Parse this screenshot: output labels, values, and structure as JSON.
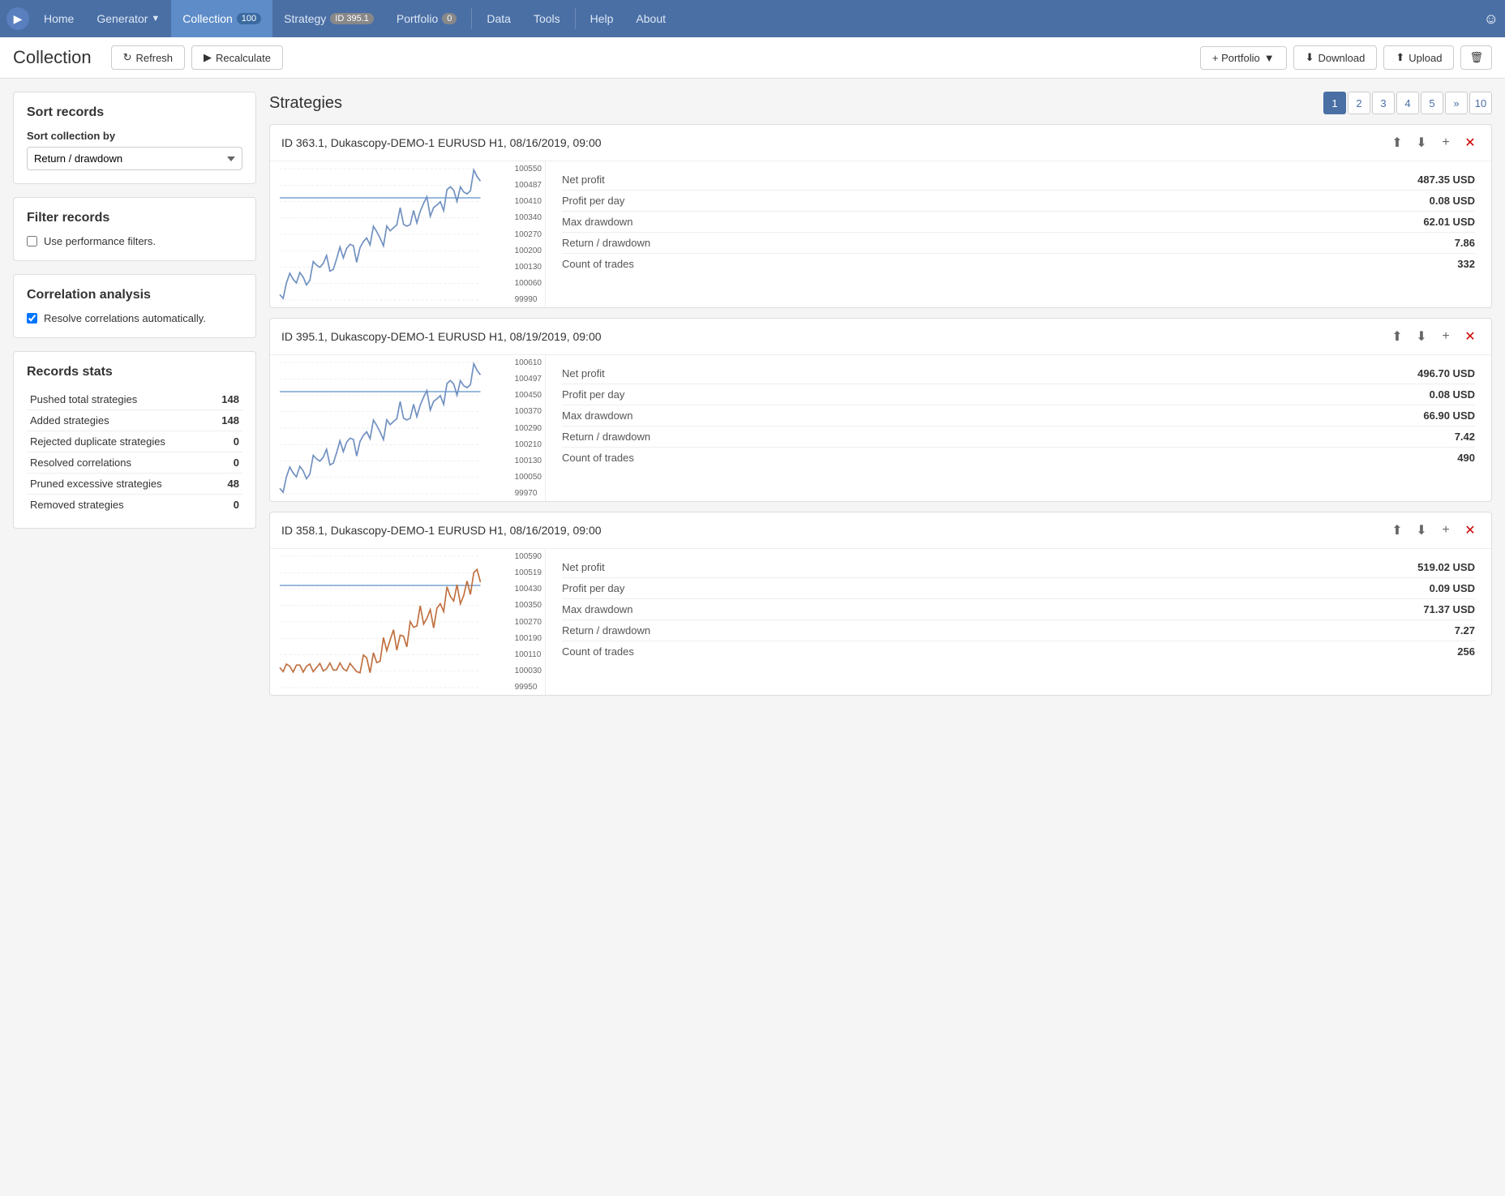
{
  "nav": {
    "home_label": "Home",
    "generator_label": "Generator",
    "collection_label": "Collection",
    "collection_badge": "100",
    "strategy_label": "Strategy",
    "strategy_id": "ID 395.1",
    "portfolio_label": "Portfolio",
    "portfolio_badge": "0",
    "data_label": "Data",
    "tools_label": "Tools",
    "help_label": "Help",
    "about_label": "About"
  },
  "toolbar": {
    "title": "Collection",
    "refresh_label": "Refresh",
    "recalculate_label": "Recalculate",
    "portfolio_label": "+ Portfolio",
    "download_label": "Download",
    "upload_label": "Upload"
  },
  "sidebar": {
    "sort_title": "Sort records",
    "sort_label": "Sort collection by",
    "sort_option": "Return / drawdown",
    "filter_title": "Filter records",
    "filter_checkbox_label": "Use performance filters.",
    "filter_checked": false,
    "correlation_title": "Correlation analysis",
    "correlation_checkbox_label": "Resolve correlations automatically.",
    "correlation_checked": true,
    "stats_title": "Records stats",
    "stats": [
      {
        "label": "Pushed total strategies",
        "value": "148"
      },
      {
        "label": "Added strategies",
        "value": "148"
      },
      {
        "label": "Rejected duplicate strategies",
        "value": "0"
      },
      {
        "label": "Resolved correlations",
        "value": "0"
      },
      {
        "label": "Pruned excessive strategies",
        "value": "48"
      },
      {
        "label": "Removed strategies",
        "value": "0"
      }
    ]
  },
  "content": {
    "title": "Strategies",
    "pagination": {
      "pages": [
        "1",
        "2",
        "3",
        "4",
        "5",
        "»",
        "10"
      ],
      "active": "1"
    },
    "strategies": [
      {
        "id": "ID 363.1",
        "info": "Dukascopy-DEMO-1 EURUSD H1, 08/16/2019, 09:00",
        "chart_labels": [
          "100550",
          "100487",
          "100410",
          "100340",
          "100270",
          "100200",
          "100130",
          "100060",
          "99990"
        ],
        "stats": [
          {
            "label": "Net profit",
            "value": "487.35 USD"
          },
          {
            "label": "Profit per day",
            "value": "0.08 USD"
          },
          {
            "label": "Max drawdown",
            "value": "62.01 USD"
          },
          {
            "label": "Return / drawdown",
            "value": "7.86"
          },
          {
            "label": "Count of trades",
            "value": "332"
          }
        ],
        "chart_color": "#7090c0",
        "trend": "up"
      },
      {
        "id": "ID 395.1",
        "info": "Dukascopy-DEMO-1 EURUSD H1, 08/19/2019, 09:00",
        "chart_labels": [
          "100610",
          "100497",
          "100450",
          "100370",
          "100290",
          "100210",
          "100130",
          "100050",
          "99970"
        ],
        "stats": [
          {
            "label": "Net profit",
            "value": "496.70 USD"
          },
          {
            "label": "Profit per day",
            "value": "0.08 USD"
          },
          {
            "label": "Max drawdown",
            "value": "66.90 USD"
          },
          {
            "label": "Return / drawdown",
            "value": "7.42"
          },
          {
            "label": "Count of trades",
            "value": "490"
          }
        ],
        "chart_color": "#7090c0",
        "trend": "up"
      },
      {
        "id": "ID 358.1",
        "info": "Dukascopy-DEMO-1 EURUSD H1, 08/16/2019, 09:00",
        "chart_labels": [
          "100590",
          "100519",
          "100430",
          "100350",
          "100270",
          "100190",
          "100110",
          "100030",
          "99950"
        ],
        "stats": [
          {
            "label": "Net profit",
            "value": "519.02 USD"
          },
          {
            "label": "Profit per day",
            "value": "0.09 USD"
          },
          {
            "label": "Max drawdown",
            "value": "71.37 USD"
          },
          {
            "label": "Return / drawdown",
            "value": "7.27"
          },
          {
            "label": "Count of trades",
            "value": "256"
          }
        ],
        "chart_color": "#c07040",
        "trend": "spike"
      }
    ]
  }
}
